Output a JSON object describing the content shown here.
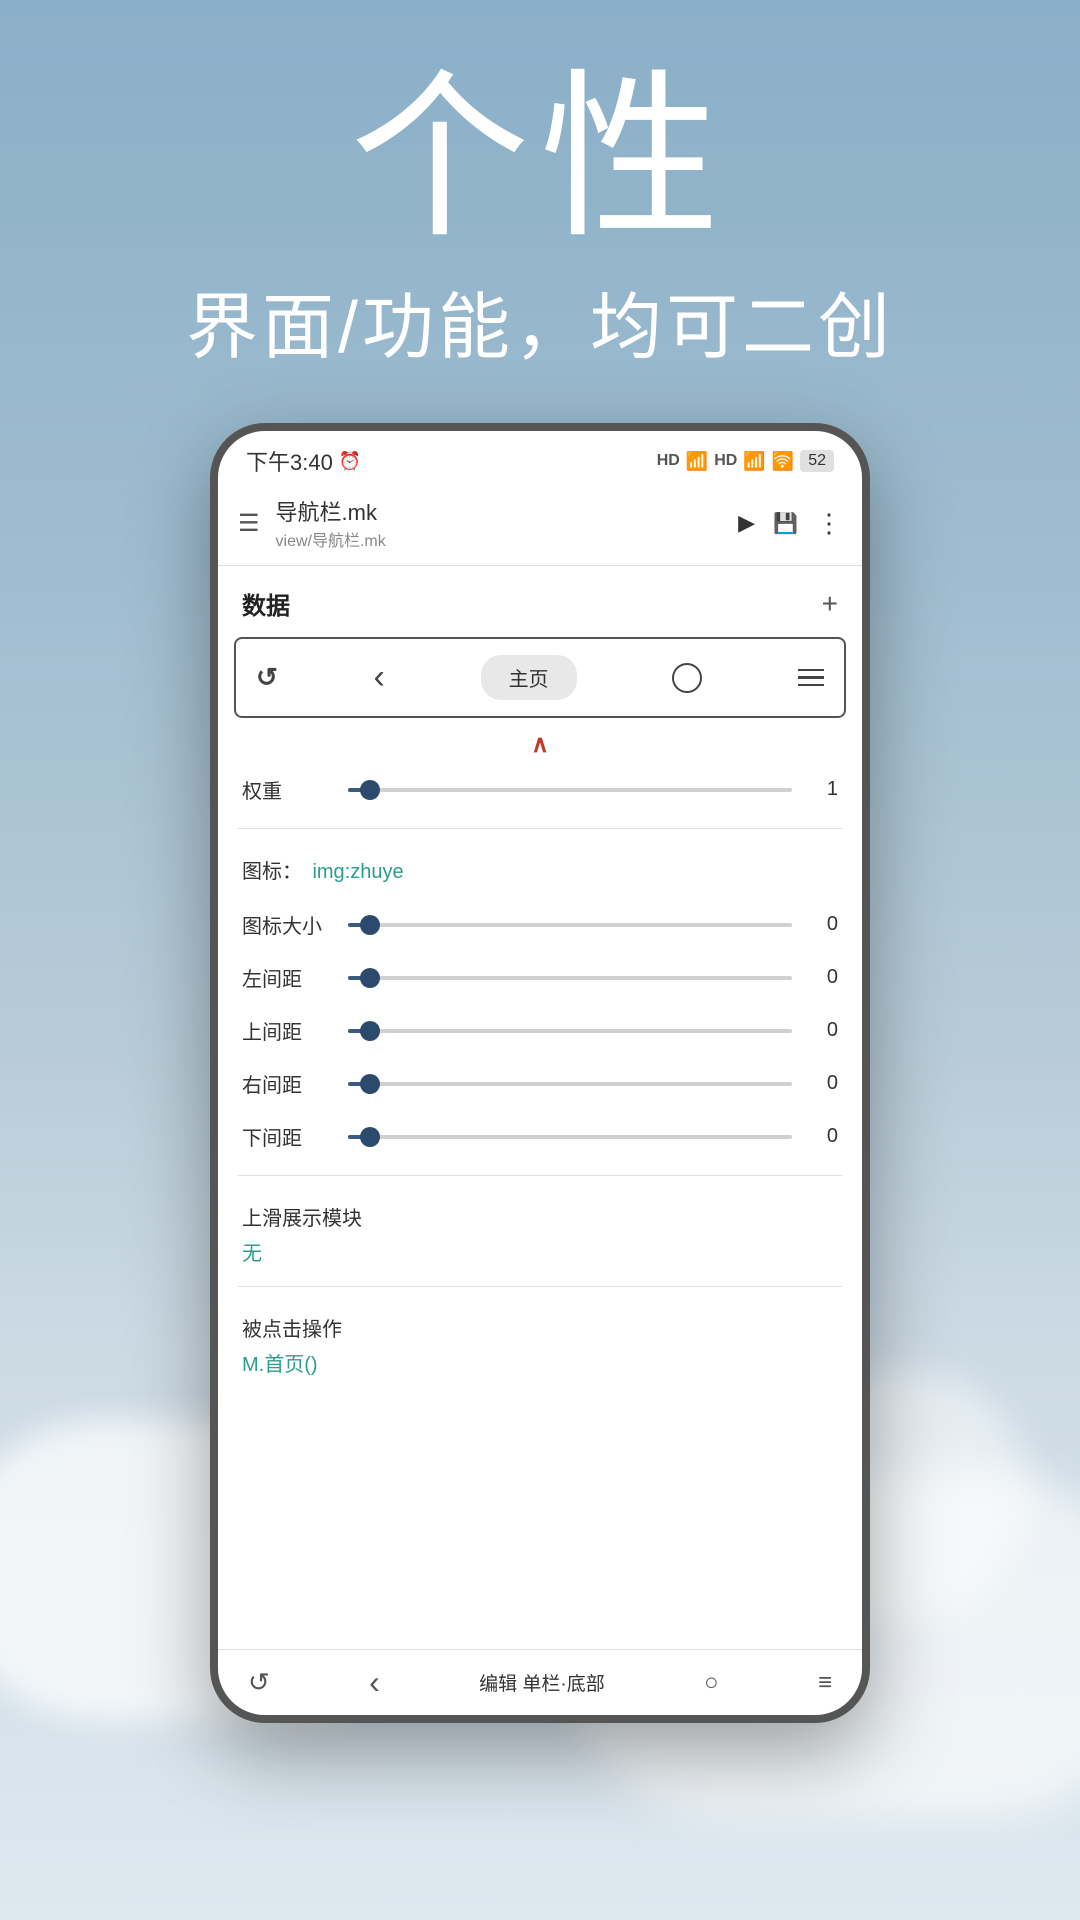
{
  "background": {
    "gradient_start": "#8aafc8",
    "gradient_end": "#dde8ef"
  },
  "hero": {
    "title": "个性",
    "subtitle": "界面/功能，均可二创"
  },
  "status_bar": {
    "time": "下午3:40",
    "clock_icon": "🕐",
    "signal1": "HD",
    "signal2": "HD",
    "wifi": "WiFi",
    "battery": "52"
  },
  "app_bar": {
    "menu_label": "☰",
    "title": "导航栏.mk",
    "subtitle": "view/导航栏.mk",
    "play_icon": "▶",
    "save_icon": "💾",
    "more_icon": "⋮"
  },
  "data_section": {
    "title": "数据",
    "add_label": "+"
  },
  "preview": {
    "refresh_icon": "↺",
    "back_icon": "‹",
    "home_label": "主页",
    "circle_icon": "○",
    "menu_icon": "≡"
  },
  "chevron": {
    "symbol": "∧",
    "color": "#c0392b"
  },
  "weight_row": {
    "label": "权重",
    "value": "1",
    "percent": 5
  },
  "icon_row": {
    "label": "图标：",
    "value": "img:zhuye"
  },
  "icon_size_row": {
    "label": "图标大小",
    "value": "0",
    "percent": 5
  },
  "left_margin_row": {
    "label": "左间距",
    "value": "0",
    "percent": 5
  },
  "top_margin_row": {
    "label": "上间距",
    "value": "0",
    "percent": 5
  },
  "right_margin_row": {
    "label": "右间距",
    "value": "0",
    "percent": 5
  },
  "bottom_margin_row": {
    "label": "下间距",
    "value": "0",
    "percent": 5
  },
  "slide_module": {
    "label": "上滑展示模块",
    "value": "无"
  },
  "click_action": {
    "label": "被点击操作",
    "value": "M.首页()"
  },
  "bottom_nav": {
    "refresh_icon": "↺",
    "back_icon": "‹",
    "center_text": "编辑 单栏·底部",
    "home_icon": "○",
    "menu_icon": "≡"
  }
}
